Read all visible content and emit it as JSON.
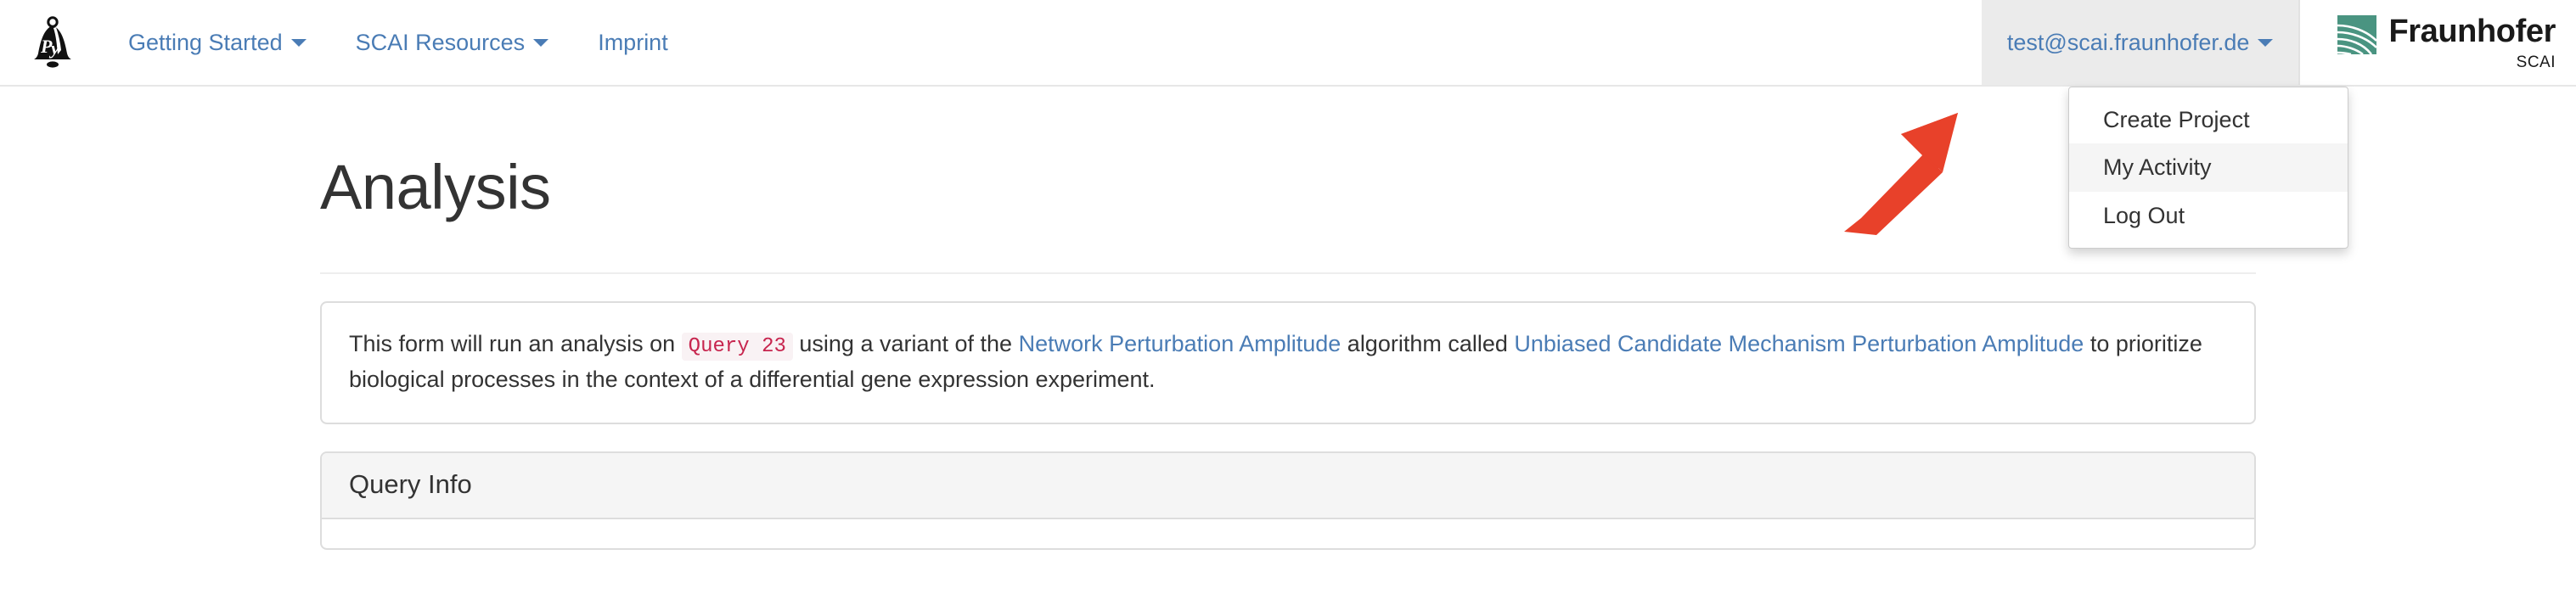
{
  "brand": {
    "logo_icon": "pybel-bell-logo",
    "alt": "PyBEL"
  },
  "navbar": {
    "items": [
      {
        "label": "Getting Started",
        "has_caret": true
      },
      {
        "label": "SCAI Resources",
        "has_caret": true
      },
      {
        "label": "Imprint",
        "has_caret": false
      }
    ],
    "user": {
      "label": "test@scai.fraunhofer.de",
      "has_caret": true
    },
    "dropdown": {
      "items": [
        {
          "label": "Create Project",
          "active": false
        },
        {
          "label": "My Activity",
          "active": true
        },
        {
          "label": "Log Out",
          "active": false
        }
      ]
    },
    "fraunhofer": {
      "mark_icon": "fraunhofer-logo-mark",
      "name": "Fraunhofer",
      "institute": "SCAI",
      "mark_color": "#4a9481"
    }
  },
  "annotation": {
    "arrow_icon": "red-arrow-pointer",
    "color": "#e8412a"
  },
  "main": {
    "title": "Analysis",
    "description": {
      "part1": "This form will run an analysis on",
      "query_code": "Query 23",
      "part2": "using a variant of the",
      "link1": "Network Perturbation Amplitude",
      "part3": "algorithm called",
      "link2": "Unbiased Candidate Mechanism Perturbation Amplitude",
      "part4": "to prioritize biological processes in the context of a differential gene expression experiment."
    },
    "query_info_panel": {
      "title": "Query Info"
    }
  },
  "colors": {
    "link": "#4a7cb5",
    "code_text": "#c7254e",
    "code_bg": "#f9f2f4",
    "panel_border": "#dddddd",
    "panel_heading_bg": "#f5f5f5",
    "dropdown_active_bg": "#f5f5f5",
    "user_menu_bg": "#ebebeb",
    "arrow": "#e8412a"
  }
}
